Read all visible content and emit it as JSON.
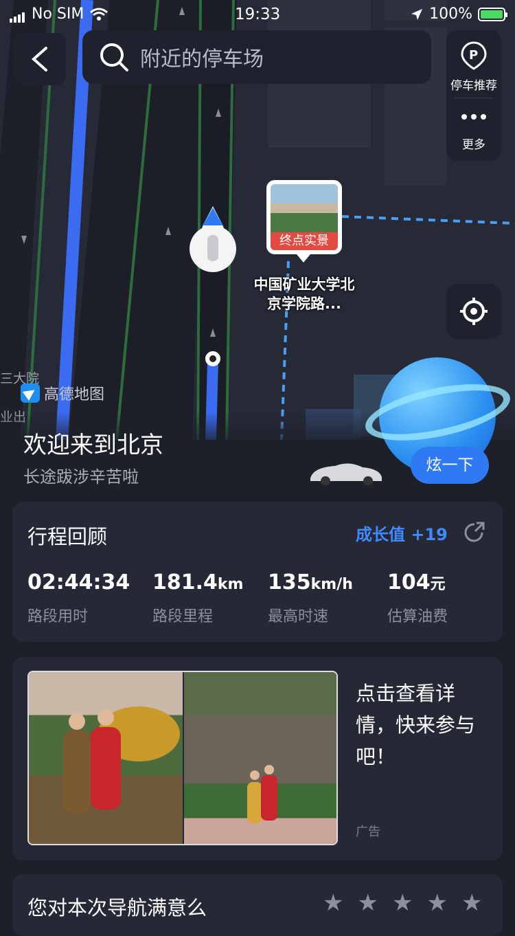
{
  "status_bar": {
    "carrier": "No SIM",
    "time": "19:33",
    "battery": "100%"
  },
  "search": {
    "placeholder": "附近的停车场"
  },
  "side_panel": {
    "parking_label": "停车推荐",
    "more_label": "更多"
  },
  "map": {
    "destination_tag": "终点实景",
    "destination_name": "中国矿业大学北京学院路...",
    "labels": [
      "三大院",
      "业出"
    ],
    "logo_text": "高德地图"
  },
  "welcome": {
    "title": "欢迎来到北京",
    "subtitle": "长途跋涉辛苦啦",
    "shine_button": "炫一下"
  },
  "trip_review": {
    "title": "行程回顾",
    "growth": "成长值 +19",
    "stats": [
      {
        "value": "02:44:34",
        "unit": "",
        "label": "路段用时"
      },
      {
        "value": "181.4",
        "unit": "km",
        "label": "路段里程"
      },
      {
        "value": "135",
        "unit": "km/h",
        "label": "最高时速"
      },
      {
        "value": "104",
        "unit": "元",
        "label": "估算油费"
      }
    ]
  },
  "ad": {
    "text": "点击查看详情，快来参与吧！",
    "tag": "广告"
  },
  "rating": {
    "question": "您对本次导航满意么",
    "stars": 5
  },
  "colors": {
    "accent": "#2f7af2",
    "route": "#3a6bf0",
    "background": "#1e2029",
    "card": "#262935"
  }
}
